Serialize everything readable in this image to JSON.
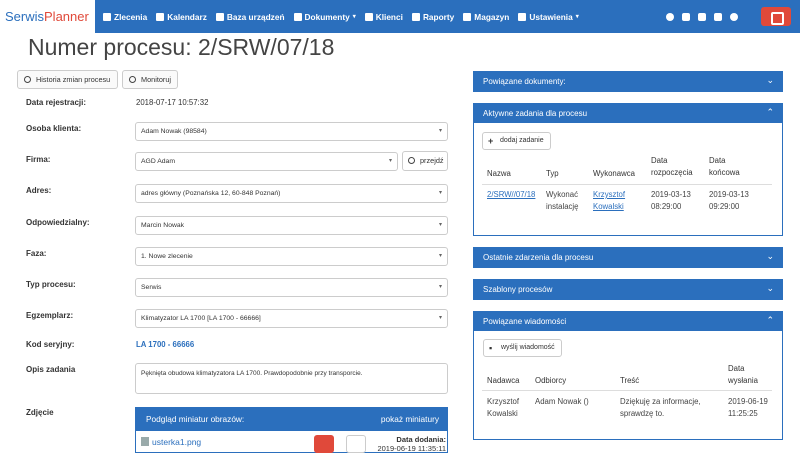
{
  "app": {
    "brand_part1": "Serwis",
    "brand_part2": "Planner"
  },
  "nav": {
    "items": [
      {
        "label": "Zlecenia",
        "icon": "list-icon"
      },
      {
        "label": "Kalendarz",
        "icon": "calendar-icon"
      },
      {
        "label": "Baza urządzeń",
        "icon": "database-icon"
      },
      {
        "label": "Dokumenty",
        "icon": "document-icon",
        "dropdown": true
      },
      {
        "label": "Klienci",
        "icon": "user-icon"
      },
      {
        "label": "Raporty",
        "icon": "bar-chart-icon"
      },
      {
        "label": "Magazyn",
        "icon": "warehouse-icon"
      },
      {
        "label": "Ustawienia",
        "icon": "gear-icon",
        "dropdown": true
      }
    ],
    "caret": "▾",
    "right_icons": [
      "search-icon",
      "chat-icon",
      "clipboard-icon",
      "notifications-icon",
      "profile-icon"
    ],
    "accent": "#2b6fbd",
    "danger": "#e0493a"
  },
  "page": {
    "title": "Numer procesu: 2/SRW/07/18"
  },
  "toolbar": {
    "history_label": "Historia zmian procesu",
    "watch_label": "Monitoruj"
  },
  "form": {
    "registration_label": "Data rejestracji:",
    "registration_value": "2018-07-17 10:57:32",
    "client_person_label": "Osoba klienta:",
    "client_person_value": "Adam Nowak (98584)",
    "company_label": "Firma:",
    "company_value": "AGD Adam",
    "goto_label": "przejdź",
    "address_label": "Adres:",
    "address_value": "adres główny (Poznańska 12, 60-848 Poznań)",
    "responsible_label": "Odpowiedzialny:",
    "responsible_value": "Marcin Nowak",
    "phase_label": "Faza:",
    "phase_value": "1. Nowe zlecenie",
    "process_type_label": "Typ procesu:",
    "process_type_value": "Serwis",
    "item_label": "Egzemplarz:",
    "item_value": "Klimatyzator LA 1700 [LA 1700 - 66666]",
    "serial_label": "Kod seryjny:",
    "serial_value": "LA 1700 - 66666",
    "task_desc_label": "Opis zadania",
    "task_desc_value": "Pęknięta obudowa klimatyzatora LA 1700. Prawdopodobnie przy transporcie.",
    "photo_label": "Zdjęcie",
    "select_arrow": "▾"
  },
  "thumbnails": {
    "header": "Podgląd miniatur obrazów:",
    "show_label": "pokaż miniatury",
    "file_name": "usterka1.png",
    "date_label": "Data dodania:",
    "date_value": "2019-06-19 11:35:11"
  },
  "panels": {
    "chevron_down": "⌄",
    "chevron_up": "⌃",
    "related_docs": "Powiązane dokumenty:",
    "active_tasks": {
      "title": "Aktywne zadania dla procesu",
      "add_label": "dodaj zadanie",
      "headers": [
        "Nazwa",
        "Typ",
        "Wykonawca",
        "Data rozpoczęcia",
        "Data końcowa"
      ],
      "row": {
        "name": "2/SRW//07/18",
        "type": "Wykonać instalację",
        "assignee": "Krzysztof Kowalski",
        "start_date": "2019-03-13",
        "start_time": "08:29:00",
        "end_date": "2019-03-13",
        "end_time": "09:29:00"
      }
    },
    "recent_events": "Ostatnie zdarzenia dla procesu",
    "templates": "Szablony procesów",
    "messages": {
      "title": "Powiązane wiadomości",
      "send_label": "wyślij wiadomość",
      "headers": [
        "Nadawca",
        "Odbiorcy",
        "Treść",
        "Data wysłania"
      ],
      "row": {
        "sender": "Krzysztof Kowalski",
        "recipients": "Adam Nowak ()",
        "content": "Dziękuję za informacje, sprawdzę to.",
        "sent_date": "2019-06-19",
        "sent_time": "11:25:25"
      }
    }
  }
}
